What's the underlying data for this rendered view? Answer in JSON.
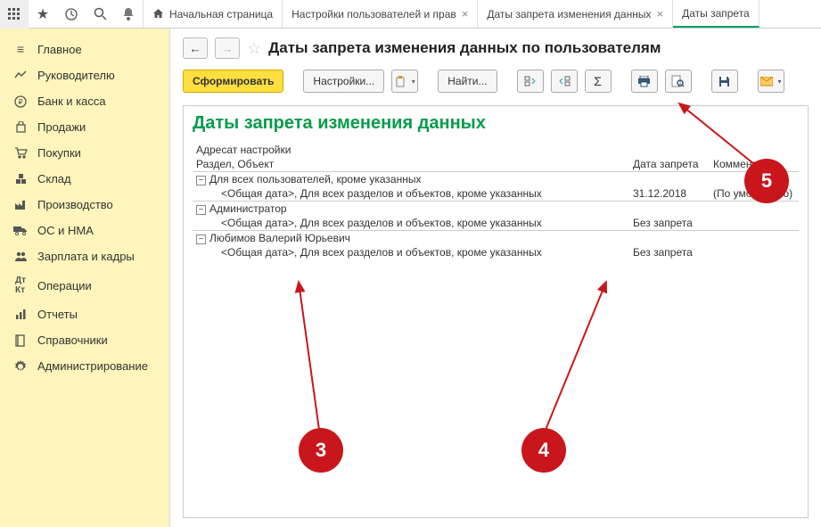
{
  "topbar": {
    "tabs": [
      {
        "label": "Начальная страница",
        "has_icon": true,
        "closable": false
      },
      {
        "label": "Настройки пользователей и прав",
        "closable": true
      },
      {
        "label": "Даты запрета изменения данных",
        "closable": true
      },
      {
        "label": "Даты запрета",
        "closable": false,
        "active": true
      }
    ]
  },
  "sidebar": {
    "items": [
      {
        "label": "Главное",
        "icon": "menu"
      },
      {
        "label": "Руководителю",
        "icon": "chart"
      },
      {
        "label": "Банк и касса",
        "icon": "ruble"
      },
      {
        "label": "Продажи",
        "icon": "bag"
      },
      {
        "label": "Покупки",
        "icon": "cart"
      },
      {
        "label": "Склад",
        "icon": "boxes"
      },
      {
        "label": "Производство",
        "icon": "factory"
      },
      {
        "label": "ОС и НМА",
        "icon": "truck"
      },
      {
        "label": "Зарплата и кадры",
        "icon": "people"
      },
      {
        "label": "Операции",
        "icon": "ops"
      },
      {
        "label": "Отчеты",
        "icon": "bars"
      },
      {
        "label": "Справочники",
        "icon": "book"
      },
      {
        "label": "Администрирование",
        "icon": "gear"
      }
    ]
  },
  "page": {
    "title": "Даты запрета изменения данных по пользователям"
  },
  "toolbar": {
    "generate": "Сформировать",
    "settings": "Настройки...",
    "find": "Найти..."
  },
  "report": {
    "title": "Даты запрета изменения данных",
    "header1": "Адресат настройки",
    "header2": "Раздел, Объект",
    "header_date": "Дата запрета",
    "header_comment": "Комментар",
    "rows": [
      {
        "group": "Для всех пользователей, кроме указанных",
        "child": "<Общая дата>, Для всех разделов и объектов, кроме указанных",
        "date": "31.12.2018",
        "comment": "(По умолчанию)"
      },
      {
        "group": "Администратор",
        "child": "<Общая дата>, Для всех разделов и объектов, кроме указанных",
        "date": "Без запрета",
        "comment": ""
      },
      {
        "group": "Любимов Валерий Юрьевич",
        "child": "<Общая дата>, Для всех разделов и объектов, кроме указанных",
        "date": "Без запрета",
        "comment": ""
      }
    ]
  },
  "annotations": {
    "b3": "3",
    "b4": "4",
    "b5": "5"
  }
}
